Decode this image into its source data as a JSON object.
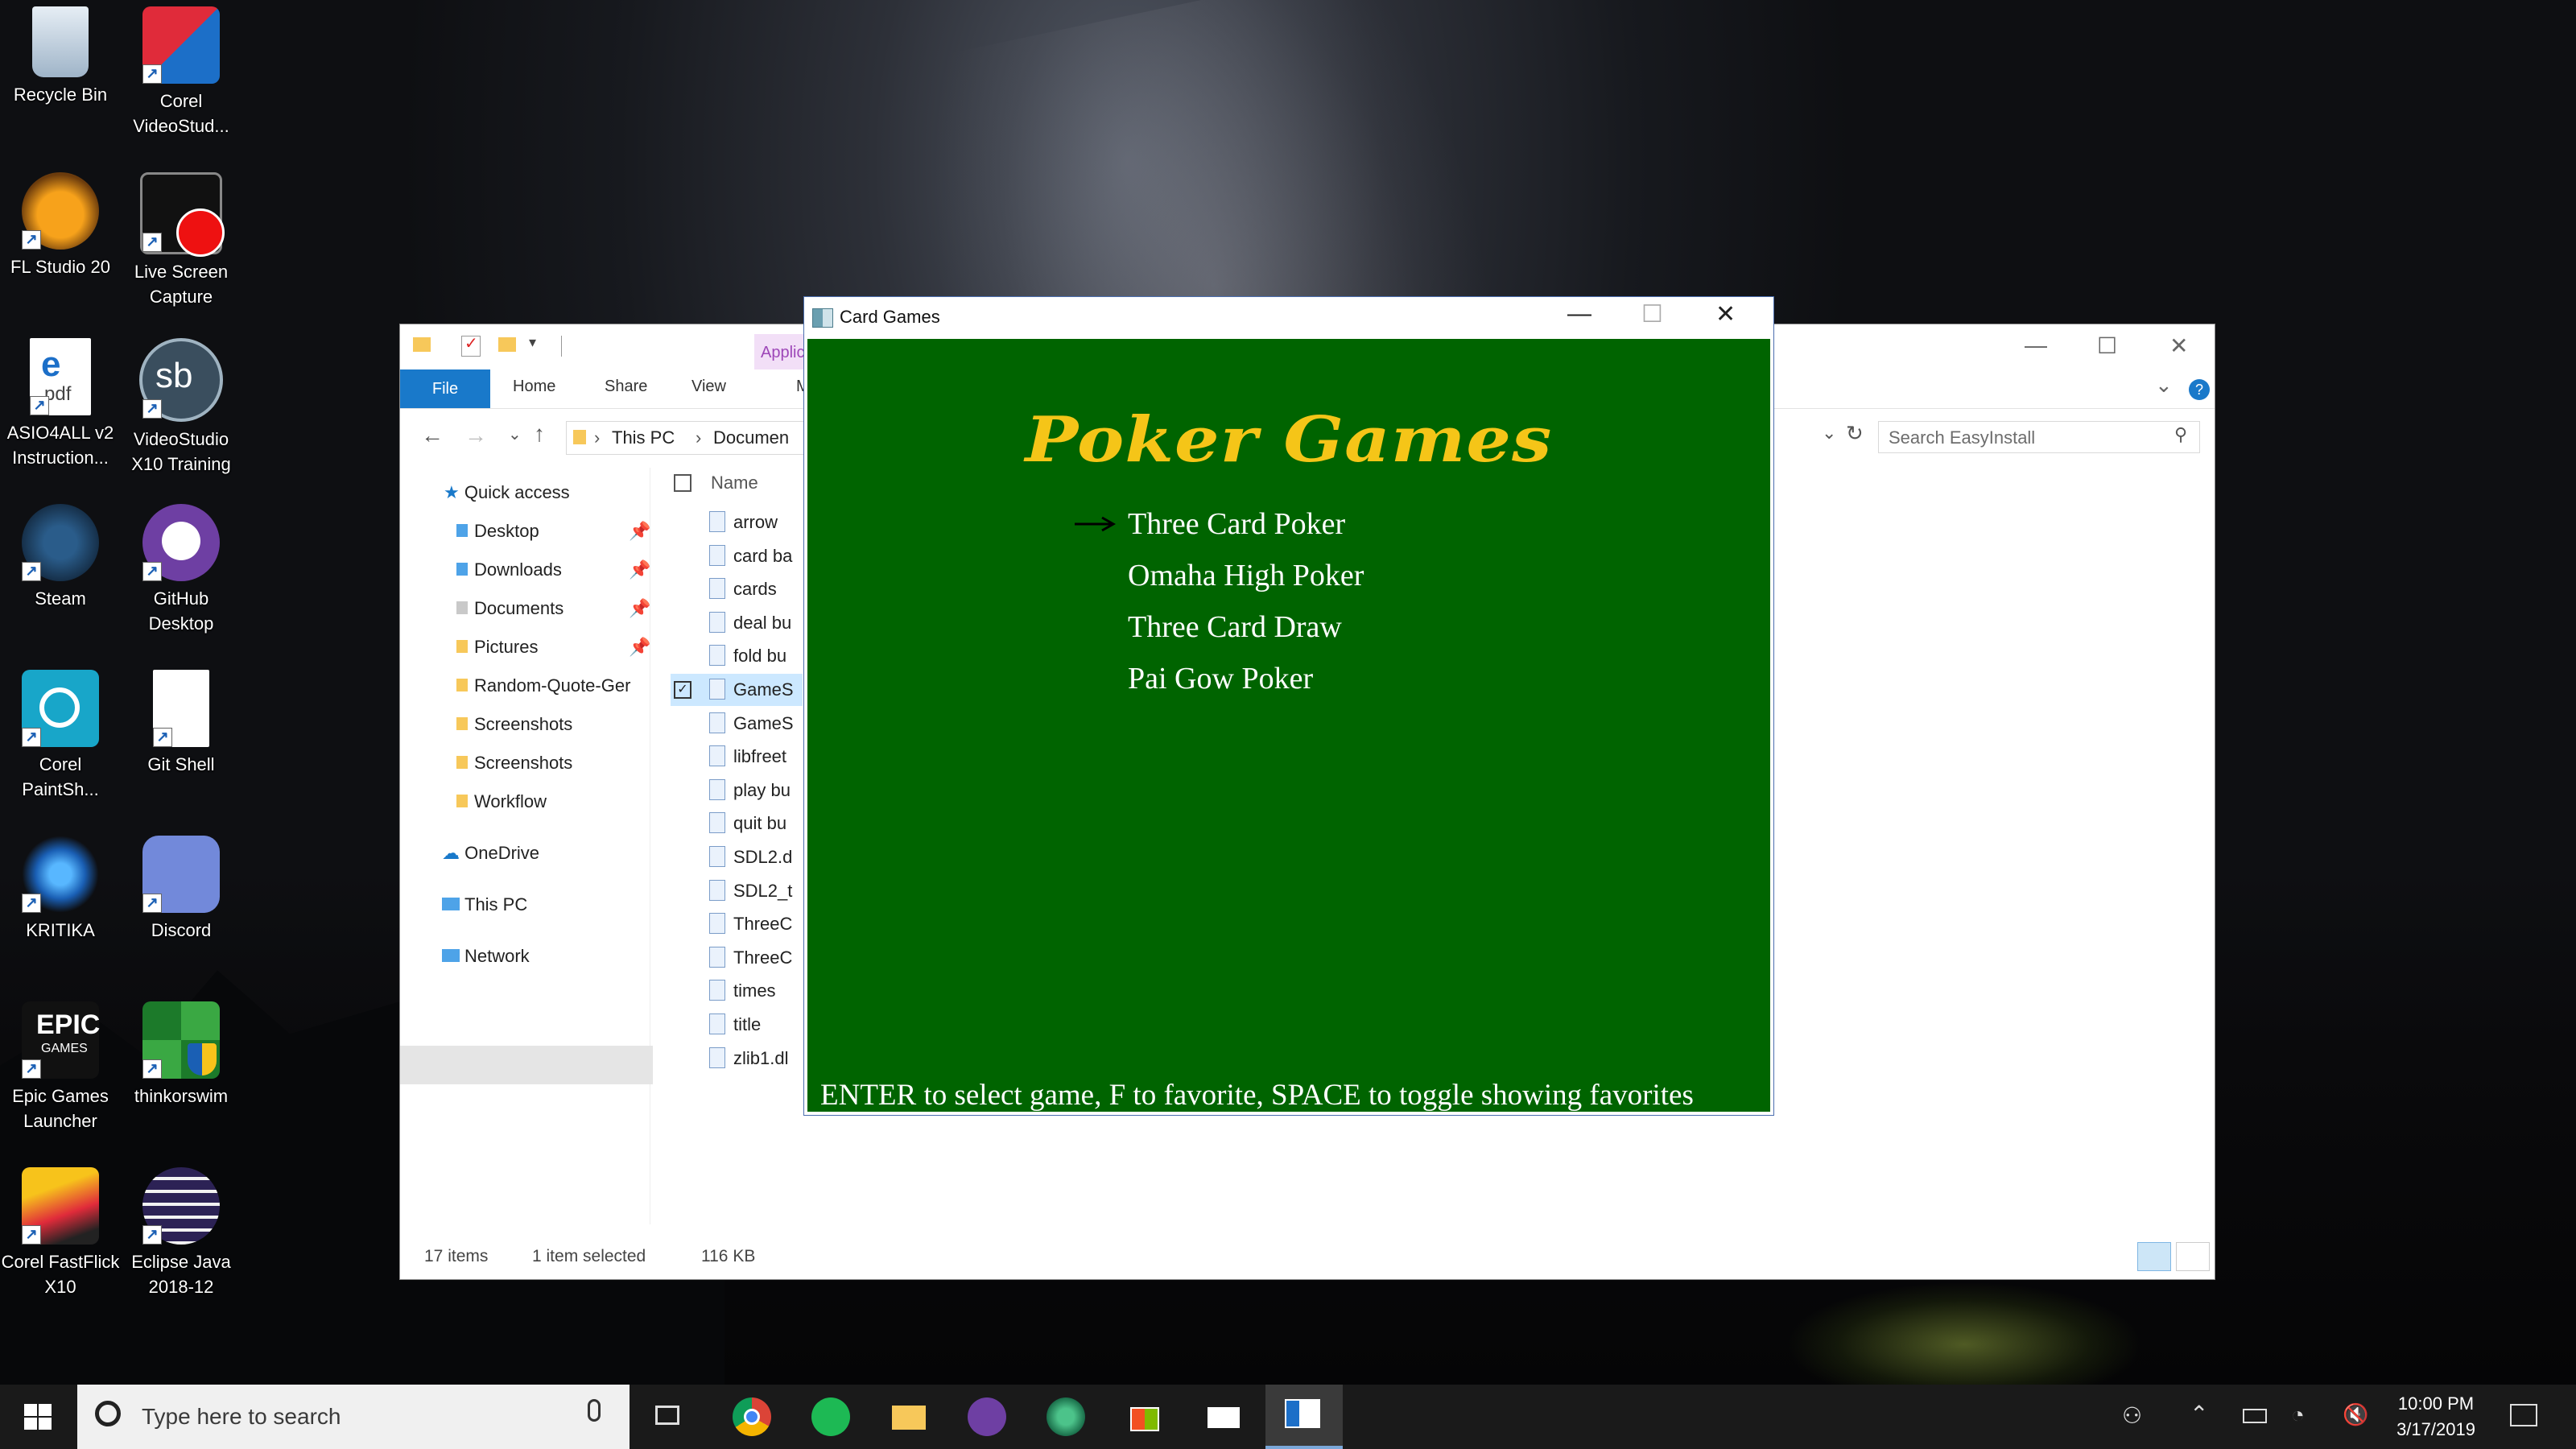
{
  "desktop": {
    "icons": [
      {
        "label": "Recycle Bin",
        "icon": "recycle-bin-icon"
      },
      {
        "label": "Corel VideoStud...",
        "icon": "corel-videostudio-icon"
      },
      {
        "label": "FL Studio 20",
        "icon": "fl-studio-icon"
      },
      {
        "label": "Live Screen Capture",
        "icon": "live-screen-capture-icon"
      },
      {
        "label": "ASIO4ALL v2 Instruction...",
        "icon": "pdf-document-icon"
      },
      {
        "label": "VideoStudio X10 Training",
        "icon": "videostudio-training-icon"
      },
      {
        "label": "Steam",
        "icon": "steam-icon"
      },
      {
        "label": "GitHub Desktop",
        "icon": "github-desktop-icon"
      },
      {
        "label": "Corel PaintSh...",
        "icon": "corel-paintshop-icon"
      },
      {
        "label": "Git Shell",
        "icon": "git-shell-icon"
      },
      {
        "label": "KRITIKA",
        "icon": "kritika-icon"
      },
      {
        "label": "Discord",
        "icon": "discord-icon"
      },
      {
        "label": "Epic Games Launcher",
        "icon": "epic-games-icon"
      },
      {
        "label": "thinkorswim",
        "icon": "thinkorswim-icon"
      },
      {
        "label": "Corel FastFlick X10",
        "icon": "corel-fastflick-icon"
      },
      {
        "label": "Eclipse Java 2018-12",
        "icon": "eclipse-icon"
      }
    ]
  },
  "explorer": {
    "ribbon_tabs": [
      "File",
      "Home",
      "Share",
      "View"
    ],
    "contextual_tab": "Applic",
    "contextual_tab_2": "M",
    "address": {
      "this_pc": "This PC",
      "folder": "Documen"
    },
    "search_placeholder": "Search EasyInstall",
    "nav": {
      "quick_access": "Quick access",
      "items": [
        "Desktop",
        "Downloads",
        "Documents",
        "Pictures",
        "Random-Quote-Ger",
        "Screenshots",
        "Screenshots",
        "Workflow"
      ],
      "onedrive": "OneDrive",
      "this_pc": "This PC",
      "network": "Network"
    },
    "column_name": "Name",
    "files": [
      "arrow",
      "card ba",
      "cards",
      "deal bu",
      "fold bu",
      "GameS",
      "GameS",
      "libfreet",
      "play bu",
      "quit bu",
      "SDL2.d",
      "SDL2_t",
      "ThreeC",
      "ThreeC",
      "times",
      "title",
      "zlib1.dl"
    ],
    "status": {
      "count": "17 items",
      "selection": "1 item selected",
      "size": "116 KB"
    }
  },
  "game": {
    "window_title": "Card Games",
    "heading": "Poker Games",
    "menu": [
      "Three Card Poker",
      "Omaha High Poker",
      "Three Card Draw",
      "Pai Gow Poker"
    ],
    "selected_index": 0,
    "footer": "ENTER to select game, F to favorite, SPACE to toggle showing favorites"
  },
  "taskbar": {
    "search_placeholder": "Type here to search",
    "apps": [
      "task-view-icon",
      "chrome-icon",
      "spotify-icon",
      "file-explorer-icon",
      "github-desktop-icon",
      "atom-like-icon",
      "store-icon",
      "mail-icon",
      "card-games-icon"
    ],
    "time": "10:00 PM",
    "date": "3/17/2019"
  },
  "colors": {
    "game_bg": "#006400",
    "heading": "#f5c518",
    "accent": "#1979ca",
    "taskbar": "#1a1a1a"
  }
}
